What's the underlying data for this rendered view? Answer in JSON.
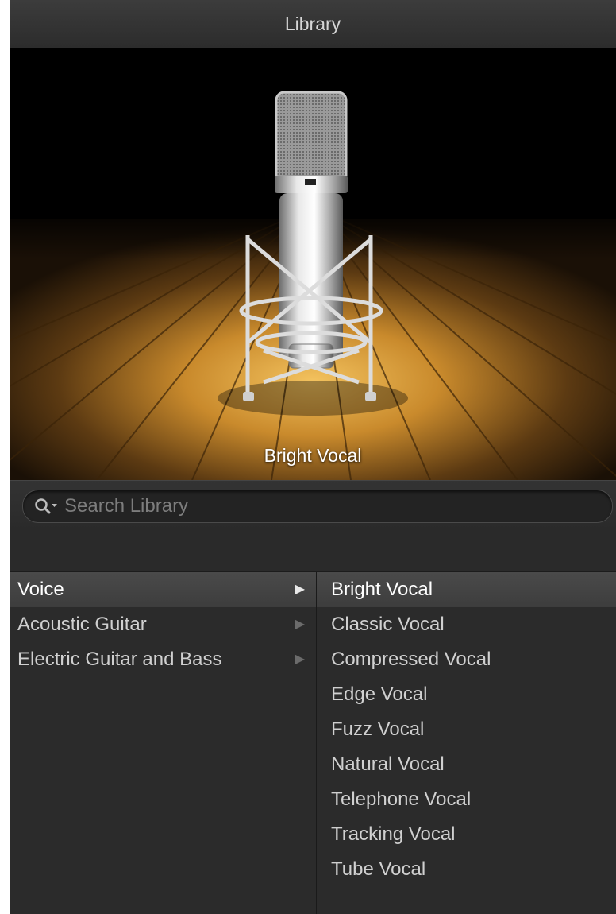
{
  "window": {
    "title": "Library"
  },
  "preview": {
    "caption": "Bright Vocal"
  },
  "search": {
    "placeholder": "Search Library",
    "value": ""
  },
  "categories": [
    {
      "label": "Voice",
      "selected": true
    },
    {
      "label": "Acoustic Guitar",
      "selected": false
    },
    {
      "label": "Electric Guitar and Bass",
      "selected": false
    }
  ],
  "patches": [
    {
      "label": "Bright Vocal",
      "selected": true
    },
    {
      "label": "Classic Vocal",
      "selected": false
    },
    {
      "label": "Compressed Vocal",
      "selected": false
    },
    {
      "label": "Edge Vocal",
      "selected": false
    },
    {
      "label": "Fuzz Vocal",
      "selected": false
    },
    {
      "label": "Natural Vocal",
      "selected": false
    },
    {
      "label": "Telephone Vocal",
      "selected": false
    },
    {
      "label": "Tracking Vocal",
      "selected": false
    },
    {
      "label": "Tube Vocal",
      "selected": false
    }
  ],
  "icons": {
    "search": "magnifier-with-dropdown",
    "disclosure": "triangle-right"
  }
}
